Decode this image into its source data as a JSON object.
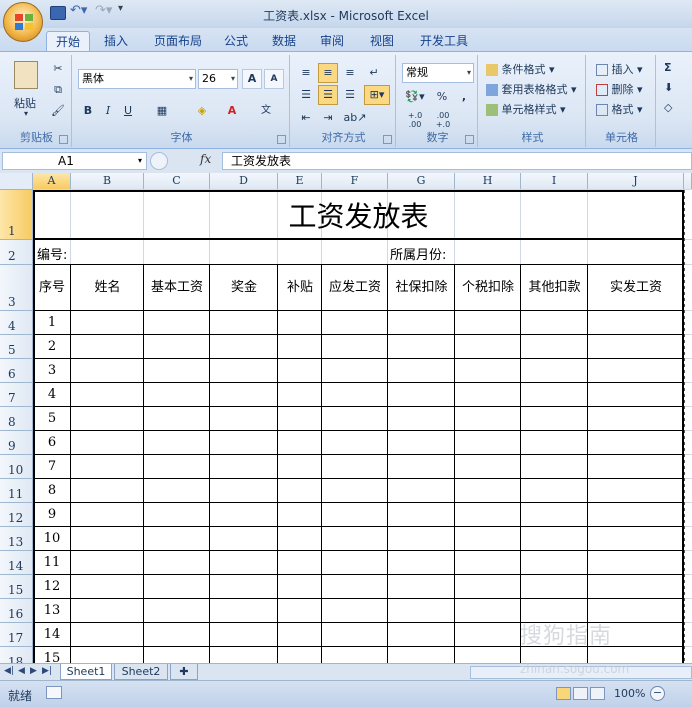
{
  "window": {
    "title": "工资表.xlsx - Microsoft Excel"
  },
  "tabs": [
    {
      "label": "开始",
      "active": true
    },
    {
      "label": "插入"
    },
    {
      "label": "页面布局"
    },
    {
      "label": "公式"
    },
    {
      "label": "数据"
    },
    {
      "label": "审阅"
    },
    {
      "label": "视图"
    },
    {
      "label": "开发工具"
    }
  ],
  "ribbon": {
    "clipboard": {
      "label": "剪贴板",
      "paste": "粘贴"
    },
    "font": {
      "label": "字体",
      "name": "黑体",
      "size": "26",
      "bold": "B",
      "italic": "I",
      "underline": "U",
      "grow": "A",
      "shrink": "A",
      "phonetic": "文"
    },
    "alignment": {
      "label": "对齐方式"
    },
    "number": {
      "label": "数字",
      "format": "常规",
      "percent": "%",
      "comma": ",",
      "inc_dec": "+.0 .00",
      "dec_dec": ".00 +.0"
    },
    "styles": {
      "label": "样式",
      "conditional": "条件格式",
      "table": "套用表格格式",
      "cell": "单元格样式"
    },
    "cells": {
      "label": "单元格",
      "insert": "插入",
      "delete": "删除",
      "format": "格式"
    },
    "editing": {
      "sum": "Σ"
    }
  },
  "formula_bar": {
    "name_box": "A1",
    "fx": "fx",
    "content": "工资发放表"
  },
  "columns": [
    "A",
    "B",
    "C",
    "D",
    "E",
    "F",
    "G",
    "H",
    "I",
    "J"
  ],
  "rows": [
    "1",
    "2",
    "3",
    "4",
    "5",
    "6",
    "7",
    "8",
    "9",
    "10",
    "11",
    "12",
    "13",
    "14",
    "15",
    "16",
    "17",
    "18"
  ],
  "sheet": {
    "title": "工资发放表",
    "serial_label": "编号:",
    "month_label": "所属月份:",
    "headers": [
      "序号",
      "姓名",
      "基本工资",
      "奖金",
      "补贴",
      "应发工资",
      "社保扣除",
      "个税扣除",
      "其他扣款",
      "实发工资"
    ],
    "serials": [
      "1",
      "2",
      "3",
      "4",
      "5",
      "6",
      "7",
      "8",
      "9",
      "10",
      "11",
      "12",
      "13",
      "14",
      "15"
    ]
  },
  "sheet_tabs": [
    {
      "label": "Sheet1",
      "active": true
    },
    {
      "label": "Sheet2"
    }
  ],
  "status": {
    "ready": "就绪",
    "zoom": "100%"
  },
  "watermark": {
    "text": "搜狗指南",
    "url": "zhinan.sogou.com"
  }
}
